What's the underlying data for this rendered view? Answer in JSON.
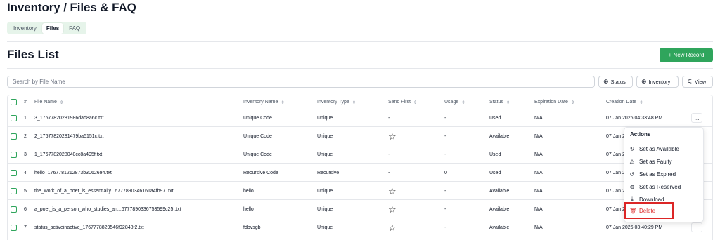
{
  "page": {
    "title": "Inventory / Files & FAQ"
  },
  "tabs": [
    {
      "label": "Inventory",
      "active": false
    },
    {
      "label": "Files",
      "active": true
    },
    {
      "label": "FAQ",
      "active": false
    }
  ],
  "section": {
    "title": "Files List",
    "new_button": "+ New Record"
  },
  "search": {
    "placeholder": "Search by File Name"
  },
  "filters": {
    "status": {
      "label": "Status",
      "icon": "plus-circle-icon"
    },
    "inventory": {
      "label": "Inventory",
      "icon": "plus-circle-icon"
    },
    "view": {
      "label": "View",
      "icon": "sliders-icon"
    }
  },
  "table": {
    "headers": {
      "num": "#",
      "file_name": "File Name",
      "inventory_name": "Inventory Name",
      "inventory_type": "Inventory Type",
      "send_first": "Send First",
      "usage": "Usage",
      "status": "Status",
      "expiration_date": "Expiration Date",
      "creation_date": "Creation Date"
    },
    "rows": [
      {
        "num": "1",
        "file_name": "3_17677820281986dad8a6c.txt",
        "inventory_name": "Unique Code",
        "inventory_type": "Unique",
        "send_first": "-",
        "usage": "-",
        "status": "Used",
        "expiration_date": "N/A",
        "creation_date": "07 Jan 2026 04:33:48 PM",
        "actions": "..."
      },
      {
        "num": "2",
        "file_name": "2_17677820281479ba5151c.txt",
        "inventory_name": "Unique Code",
        "inventory_type": "Unique",
        "send_first": "star",
        "usage": "-",
        "status": "Available",
        "expiration_date": "N/A",
        "creation_date": "07 Jan 2",
        "actions": ""
      },
      {
        "num": "3",
        "file_name": "1_1767782028040cc8a495f.txt",
        "inventory_name": "Unique Code",
        "inventory_type": "Unique",
        "send_first": "-",
        "usage": "-",
        "status": "Used",
        "expiration_date": "N/A",
        "creation_date": "07 Jan 2",
        "actions": ""
      },
      {
        "num": "4",
        "file_name": "hello_1767781212873b3062694.txt",
        "inventory_name": "Recursive Code",
        "inventory_type": "Recursive",
        "send_first": "-",
        "usage": "0",
        "status": "Used",
        "expiration_date": "N/A",
        "creation_date": "07 Jan 2",
        "actions": ""
      },
      {
        "num": "5",
        "file_name": "the_work_of_a_poet_is_essentially...6777890346161a4fb97 .txt",
        "inventory_name": "hello",
        "inventory_type": "Unique",
        "send_first": "star",
        "usage": "-",
        "status": "Available",
        "expiration_date": "N/A",
        "creation_date": "07 Jan 2",
        "actions": ""
      },
      {
        "num": "6",
        "file_name": "a_poet_is_a_person_who_studies_an...6777890336753599c25 .txt",
        "inventory_name": "hello",
        "inventory_type": "Unique",
        "send_first": "star",
        "usage": "-",
        "status": "Available",
        "expiration_date": "N/A",
        "creation_date": "07 Jan 2",
        "actions": ""
      },
      {
        "num": "7",
        "file_name": "status_activeinactive_1767778829546f92848f2.txt",
        "inventory_name": "fdbvsgb",
        "inventory_type": "Unique",
        "send_first": "star",
        "usage": "-",
        "status": "Available",
        "expiration_date": "N/A",
        "creation_date": "07 Jan 2026 03:40:29 PM",
        "actions": "..."
      }
    ]
  },
  "menu": {
    "title": "Actions",
    "items": [
      {
        "label": "Set as Available",
        "icon": "refresh-icon"
      },
      {
        "label": "Set as Faulty",
        "icon": "warning-icon"
      },
      {
        "label": "Set as Expired",
        "icon": "history-icon"
      },
      {
        "label": "Set as Reserved",
        "icon": "reserved-icon"
      },
      {
        "label": "Download",
        "icon": "download-icon"
      },
      {
        "label": "Delete",
        "icon": "trash-icon"
      }
    ]
  },
  "colors": {
    "accent": "#2fa55c",
    "danger": "#dc2626",
    "tab_bg": "#e6f4ea"
  }
}
